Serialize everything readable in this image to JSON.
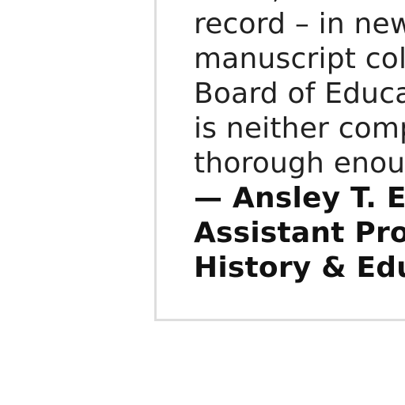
{
  "quote": {
    "lines": [
      "some, ",
      "record – in new",
      "manuscript coll",
      "Board of Educa",
      "is neither comp",
      "thorough enoug"
    ],
    "attribution": [
      "— Ansley T. Eri",
      "Assistant Profe",
      "History & Educ"
    ]
  }
}
